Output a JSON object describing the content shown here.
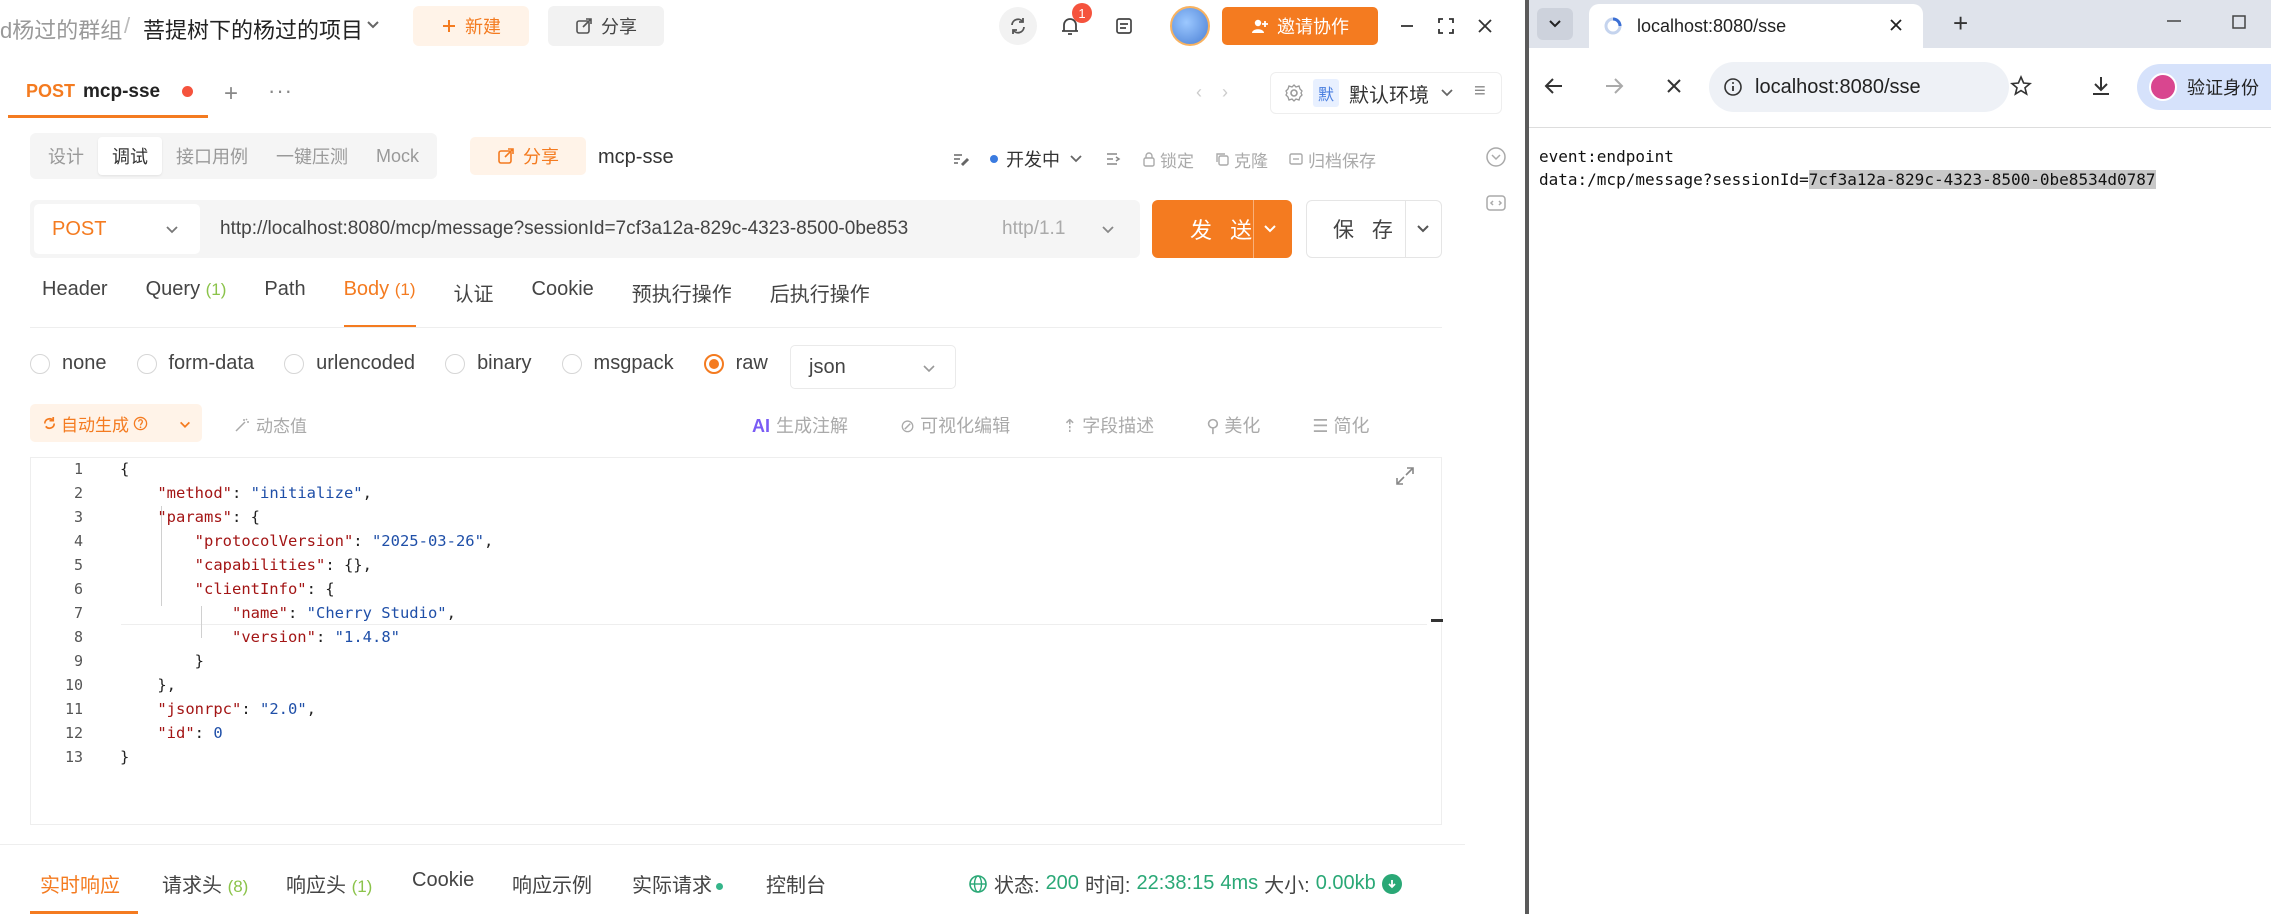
{
  "app": {
    "breadcrumb": {
      "group": "d杨过的群组",
      "separator": "/",
      "project": "菩提树下的杨过的项目"
    },
    "toolbar": {
      "new_label": "新建",
      "share_label": "分享",
      "notification_count": "1",
      "invite_label": "邀请协作"
    },
    "request_tab": {
      "method": "POST",
      "name": "mcp-sse"
    },
    "environment": {
      "badge": "默",
      "label": "默认环境"
    },
    "mode_tabs": [
      "设计",
      "调试",
      "接口用例",
      "一键压测",
      "Mock"
    ],
    "mode_active": "调试",
    "share_label": "分享",
    "request_name": "mcp-sse",
    "status_label": "开发中",
    "tools": {
      "lock": "锁定",
      "clone": "克隆",
      "archive": "归档保存"
    },
    "method": "POST",
    "url": "http://localhost:8080/mcp/message?sessionId=7cf3a12a-829c-4323-8500-0be853",
    "http_version": "http/1.1",
    "send_label": "发 送",
    "save_label": "保 存",
    "param_tabs": [
      {
        "label": "Header",
        "count": ""
      },
      {
        "label": "Query",
        "count": "(1)"
      },
      {
        "label": "Path",
        "count": ""
      },
      {
        "label": "Body",
        "count": "(1)"
      },
      {
        "label": "认证",
        "count": ""
      },
      {
        "label": "Cookie",
        "count": ""
      },
      {
        "label": "预执行操作",
        "count": ""
      },
      {
        "label": "后执行操作",
        "count": ""
      }
    ],
    "body_types": [
      "none",
      "form-data",
      "urlencoded",
      "binary",
      "msgpack",
      "raw"
    ],
    "body_type_selected": "raw",
    "body_format": "json",
    "auto_gen_label": "自动生成",
    "dynamic_value_label": "动态值",
    "editor_tools": {
      "ai": "AI",
      "gen_comment": "生成注解",
      "visual_edit": "可视化编辑",
      "field_desc": "字段描述",
      "beautify": "美化",
      "simplify": "简化"
    },
    "code_lines": [
      {
        "n": "1",
        "t": "{"
      },
      {
        "n": "2",
        "t": "    \"method\": \"initialize\","
      },
      {
        "n": "3",
        "t": "    \"params\": {"
      },
      {
        "n": "4",
        "t": "        \"protocolVersion\": \"2025-03-26\","
      },
      {
        "n": "5",
        "t": "        \"capabilities\": {},"
      },
      {
        "n": "6",
        "t": "        \"clientInfo\": {"
      },
      {
        "n": "7",
        "t": "            \"name\": \"Cherry Studio\","
      },
      {
        "n": "8",
        "t": "            \"version\": \"1.4.8\""
      },
      {
        "n": "9",
        "t": "        }"
      },
      {
        "n": "10",
        "t": "    },"
      },
      {
        "n": "11",
        "t": "    \"jsonrpc\": \"2.0\","
      },
      {
        "n": "12",
        "t": "    \"id\": 0"
      },
      {
        "n": "13",
        "t": "}"
      }
    ],
    "response_tabs": [
      {
        "label": "实时响应",
        "count": ""
      },
      {
        "label": "请求头",
        "count": "(8)"
      },
      {
        "label": "响应头",
        "count": "(1)"
      },
      {
        "label": "Cookie",
        "count": ""
      },
      {
        "label": "响应示例",
        "count": ""
      },
      {
        "label": "实际请求",
        "count": ""
      },
      {
        "label": "控制台",
        "count": ""
      }
    ],
    "response_status": {
      "status_label": "状态:",
      "status": "200",
      "time_label": "时间:",
      "time": "22:38:15",
      "duration": "4ms",
      "size_label": "大小:",
      "size": "0.00kb"
    },
    "colors": {
      "accent": "#f47b20",
      "success": "#2aa876",
      "count": "#8bc34a"
    }
  },
  "browser": {
    "tab_title": "localhost:8080/sse",
    "address": "localhost:8080/sse",
    "verify_label": "验证身份",
    "content_line1": "event:endpoint",
    "content_line2_prefix": "data:/mcp/message?sessionId=",
    "content_line2_selected": "7cf3a12a-829c-4323-8500-0be8534d0787"
  }
}
